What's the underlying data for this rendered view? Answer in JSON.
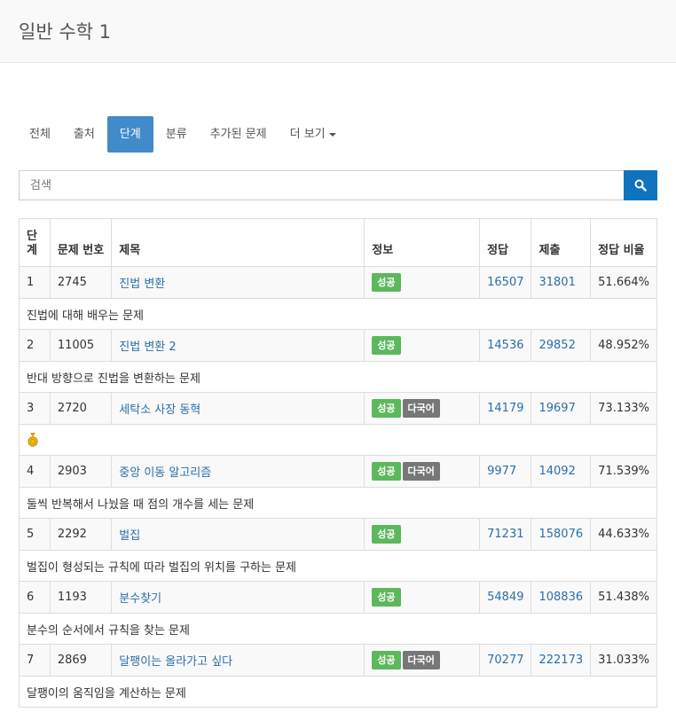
{
  "header": {
    "title": "일반 수학 1"
  },
  "tabs": [
    {
      "label": "전체",
      "active": false
    },
    {
      "label": "출처",
      "active": false
    },
    {
      "label": "단계",
      "active": true
    },
    {
      "label": "분류",
      "active": false
    },
    {
      "label": "추가된 문제",
      "active": false
    },
    {
      "label": "더 보기",
      "active": false,
      "dropdown": true
    }
  ],
  "search": {
    "placeholder": "검색",
    "button_icon": "search-icon"
  },
  "table": {
    "columns": [
      "단계",
      "문제 번호",
      "제목",
      "정보",
      "정답",
      "제출",
      "정답 비율"
    ],
    "rows": [
      {
        "step": "1",
        "id": "2745",
        "title": "진법 변환",
        "badges": [
          "성공"
        ],
        "correct": "16507",
        "submit": "31801",
        "ratio": "51.664%",
        "desc": "진법에 대해 배우는 문제"
      },
      {
        "step": "2",
        "id": "11005",
        "title": "진법 변환 2",
        "badges": [
          "성공"
        ],
        "correct": "14536",
        "submit": "29852",
        "ratio": "48.952%",
        "desc": "반대 방향으로 진법을 변환하는 문제"
      },
      {
        "step": "3",
        "id": "2720",
        "title": "세탁소 사장 동혁",
        "badges": [
          "성공",
          "다국어"
        ],
        "correct": "14179",
        "submit": "19697",
        "ratio": "73.133%",
        "desc": "",
        "desc_icon": "medal-icon"
      },
      {
        "step": "4",
        "id": "2903",
        "title": "중앙 이동 알고리즘",
        "badges": [
          "성공",
          "다국어"
        ],
        "correct": "9977",
        "submit": "14092",
        "ratio": "71.539%",
        "desc": "둘씩 반복해서 나눴을 때 점의 개수를 세는 문제"
      },
      {
        "step": "5",
        "id": "2292",
        "title": "벌집",
        "badges": [
          "성공"
        ],
        "correct": "71231",
        "submit": "158076",
        "ratio": "44.633%",
        "desc": "벌집이 형성되는 규칙에 따라 벌집의 위치를 구하는 문제"
      },
      {
        "step": "6",
        "id": "1193",
        "title": "분수찾기",
        "badges": [
          "성공"
        ],
        "correct": "54849",
        "submit": "108836",
        "ratio": "51.438%",
        "desc": "분수의 순서에서 규칙을 찾는 문제"
      },
      {
        "step": "7",
        "id": "2869",
        "title": "달팽이는 올라가고 싶다",
        "badges": [
          "성공",
          "다국어"
        ],
        "correct": "70277",
        "submit": "222173",
        "ratio": "31.033%",
        "desc": "달팽이의 움직임을 계산하는 문제"
      }
    ]
  },
  "colors": {
    "active_tab": "#428bca",
    "search_button": "#0f74bd",
    "success_badge": "#5cb85c",
    "multilang_badge": "#777777",
    "link": "#2a6fa8"
  }
}
